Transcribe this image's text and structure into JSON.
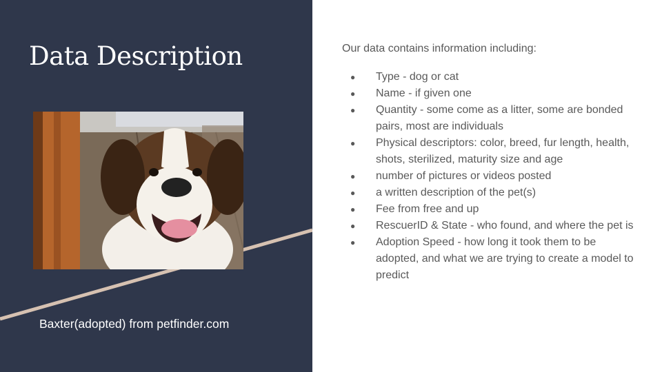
{
  "slide": {
    "title": "Data Description",
    "caption": "Baxter(adopted) from petfinder.com",
    "intro": "Our data contains information including:",
    "bullets": [
      "Type - dog or cat",
      "Name - if given one",
      "Quantity - some come as a litter, some are bonded pairs, most are individuals",
      "Physical descriptors: color, breed, fur length, health, shots, sterilized, maturity size and age",
      "number of pictures or videos posted",
      "a written description of the pet(s)",
      "Fee from free and up",
      "RescuerID & State - who found, and where the pet is",
      "Adoption Speed - how long it took them to be adopted, and what we are trying to create a model to predict"
    ]
  },
  "colors": {
    "panel": "#2f374b",
    "accent_line": "#d6c1b1",
    "body_text": "#595959"
  }
}
